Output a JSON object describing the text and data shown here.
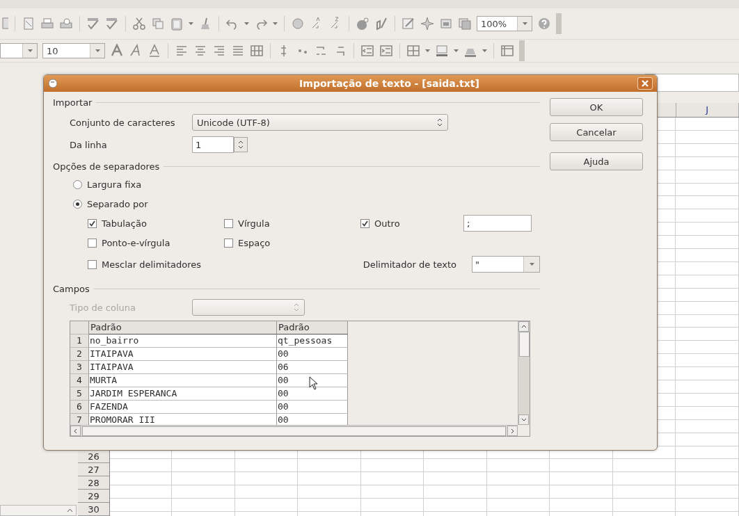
{
  "toolbar": {
    "zoom": "100%"
  },
  "format_bar": {
    "font_size": "10"
  },
  "sheet": {
    "column_header": "J",
    "row_numbers": [
      "26",
      "27",
      "28",
      "29",
      "30"
    ]
  },
  "dialog": {
    "title": "Importação de texto - [saida.txt]",
    "import": {
      "heading": "Importar",
      "charset_label": "Conjunto de caracteres",
      "charset_value": "Unicode (UTF-8)",
      "from_row_label": "Da linha",
      "from_row_value": "1"
    },
    "separators": {
      "heading": "Opções de separadores",
      "modes": [
        {
          "label": "Largura fixa",
          "selected": false
        },
        {
          "label": "Separado por",
          "selected": true
        }
      ],
      "options": [
        {
          "label": "Tabulação",
          "checked": true
        },
        {
          "label": "Vírgula",
          "checked": false
        },
        {
          "label": "Outro",
          "checked": true
        },
        {
          "label": "Ponto-e-vírgula",
          "checked": false
        },
        {
          "label": "Espaço",
          "checked": false
        }
      ],
      "other_value": ";",
      "merge": {
        "label": "Mesclar delimitadores",
        "checked": false
      },
      "text_delimiter_label": "Delimitador de texto",
      "text_delimiter_value": "\""
    },
    "fields": {
      "heading": "Campos",
      "column_type_label": "Tipo de coluna",
      "column_type_disabled": true,
      "columns": [
        "Padrão",
        "Padrão"
      ],
      "rows": [
        {
          "number": "1",
          "cells": [
            "no_bairro",
            "qt_pessoas"
          ]
        },
        {
          "number": "2",
          "cells": [
            "ITAIPAVA",
            "00"
          ]
        },
        {
          "number": "3",
          "cells": [
            "ITAIPAVA",
            "06"
          ]
        },
        {
          "number": "4",
          "cells": [
            "MURTA",
            "00"
          ]
        },
        {
          "number": "5",
          "cells": [
            "JARDIM ESPERANCA",
            "00"
          ]
        },
        {
          "number": "6",
          "cells": [
            "FAZENDA",
            "00"
          ]
        },
        {
          "number": "7",
          "cells": [
            "PROMORAR III",
            "00"
          ]
        }
      ]
    },
    "buttons": [
      "OK",
      "Cancelar",
      "Ajuda"
    ]
  }
}
